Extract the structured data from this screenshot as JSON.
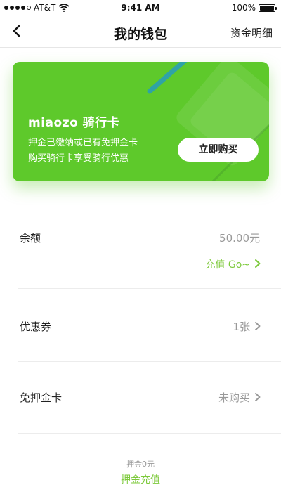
{
  "status_bar": {
    "carrier": "AT&T",
    "time": "9:41 AM",
    "battery": "100%",
    "battery_level": 1.0
  },
  "nav": {
    "title": "我的钱包",
    "right_action": "资金明细"
  },
  "card": {
    "title": "miaozo 骑行卡",
    "line1": "押金已缴纳或已有免押金卡",
    "line2": "购买骑行卡享受骑行优惠",
    "button": "立即购买",
    "colors": {
      "primary": "#5ec92b",
      "stripe": "#2fa3a6"
    }
  },
  "balance": {
    "label": "余额",
    "value": "50.00元",
    "recharge": "充值 Go~"
  },
  "coupons": {
    "label": "优惠券",
    "value": "1张"
  },
  "deposit_card": {
    "label": "免押金卡",
    "value": "未购买"
  },
  "footer": {
    "deposit_text": "押金0元",
    "deposit_link": "押金充值"
  },
  "colors": {
    "accent": "#7cc93a",
    "muted": "#999999"
  }
}
